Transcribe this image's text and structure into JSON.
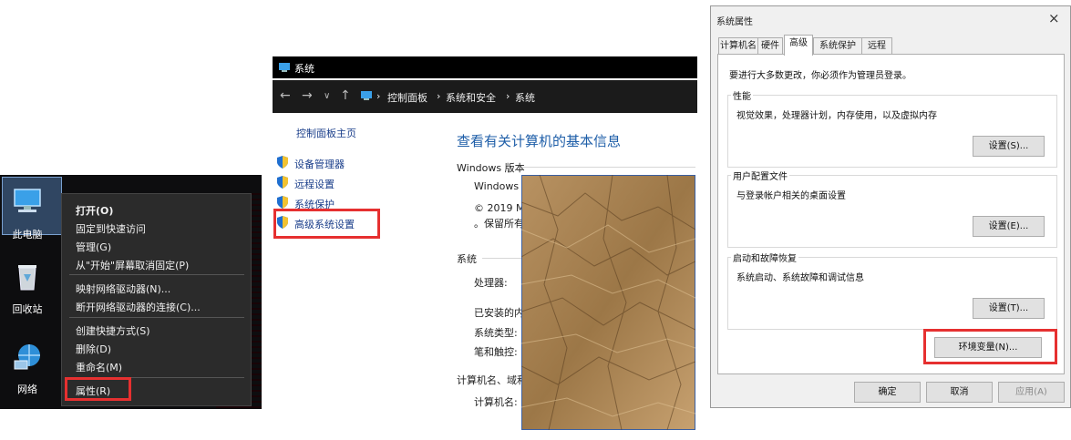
{
  "desktop": {
    "icons": [
      {
        "label": "此电脑",
        "icon": "computer-icon"
      },
      {
        "label": "回收站",
        "icon": "recycle-bin-icon"
      },
      {
        "label": "网络",
        "icon": "network-icon"
      }
    ],
    "context_menu": {
      "items": [
        "打开(O)",
        "固定到快速访问",
        "管理(G)",
        "从\"开始\"屏幕取消固定(P)",
        "映射网络驱动器(N)...",
        "断开网络驱动器的连接(C)...",
        "创建快捷方式(S)",
        "删除(D)",
        "重命名(M)",
        "属性(R)"
      ],
      "highlighted": "属性(R)"
    }
  },
  "system_window": {
    "title": "系统",
    "breadcrumb": [
      "控制面板",
      "系统和安全",
      "系统"
    ],
    "sidebar": {
      "home": "控制面板主页",
      "links": [
        "设备管理器",
        "远程设置",
        "系统保护",
        "高级系统设置"
      ],
      "highlighted": "高级系统设置"
    },
    "heading": "查看有关计算机的基本信息",
    "windows_edition": {
      "section": "Windows 版本",
      "line1": "Windows",
      "line2": "© 2019 M",
      "line3": "。保留所有"
    },
    "system_section": {
      "section": "系统",
      "processor_label": "处理器:",
      "installed_ram_label": "已安装的内",
      "system_type_label": "系统类型:",
      "pen_touch_label": "笔和触控:"
    },
    "computer_name_section": {
      "section": "计算机名、域和",
      "name_label": "计算机名:"
    }
  },
  "properties_dialog": {
    "title": "系统属性",
    "close_glyph": "×",
    "tabs": [
      "计算机名",
      "硬件",
      "高级",
      "系统保护",
      "远程"
    ],
    "active_tab": "高级",
    "admin_note": "要进行大多数更改，你必须作为管理员登录。",
    "performance": {
      "label": "性能",
      "desc": "视觉效果，处理器计划，内存使用，以及虚拟内存",
      "button": "设置(S)..."
    },
    "user_profiles": {
      "label": "用户配置文件",
      "desc": "与登录帐户相关的桌面设置",
      "button": "设置(E)..."
    },
    "startup_recovery": {
      "label": "启动和故障恢复",
      "desc": "系统启动、系统故障和调试信息",
      "button": "设置(T)..."
    },
    "env_button": "环境变量(N)...",
    "ok": "确定",
    "cancel": "取消",
    "apply": "应用(A)"
  },
  "colors": {
    "highlight_red": "#e63030",
    "link_blue": "#1a3e8a",
    "heading_blue": "#1e5ea8"
  }
}
